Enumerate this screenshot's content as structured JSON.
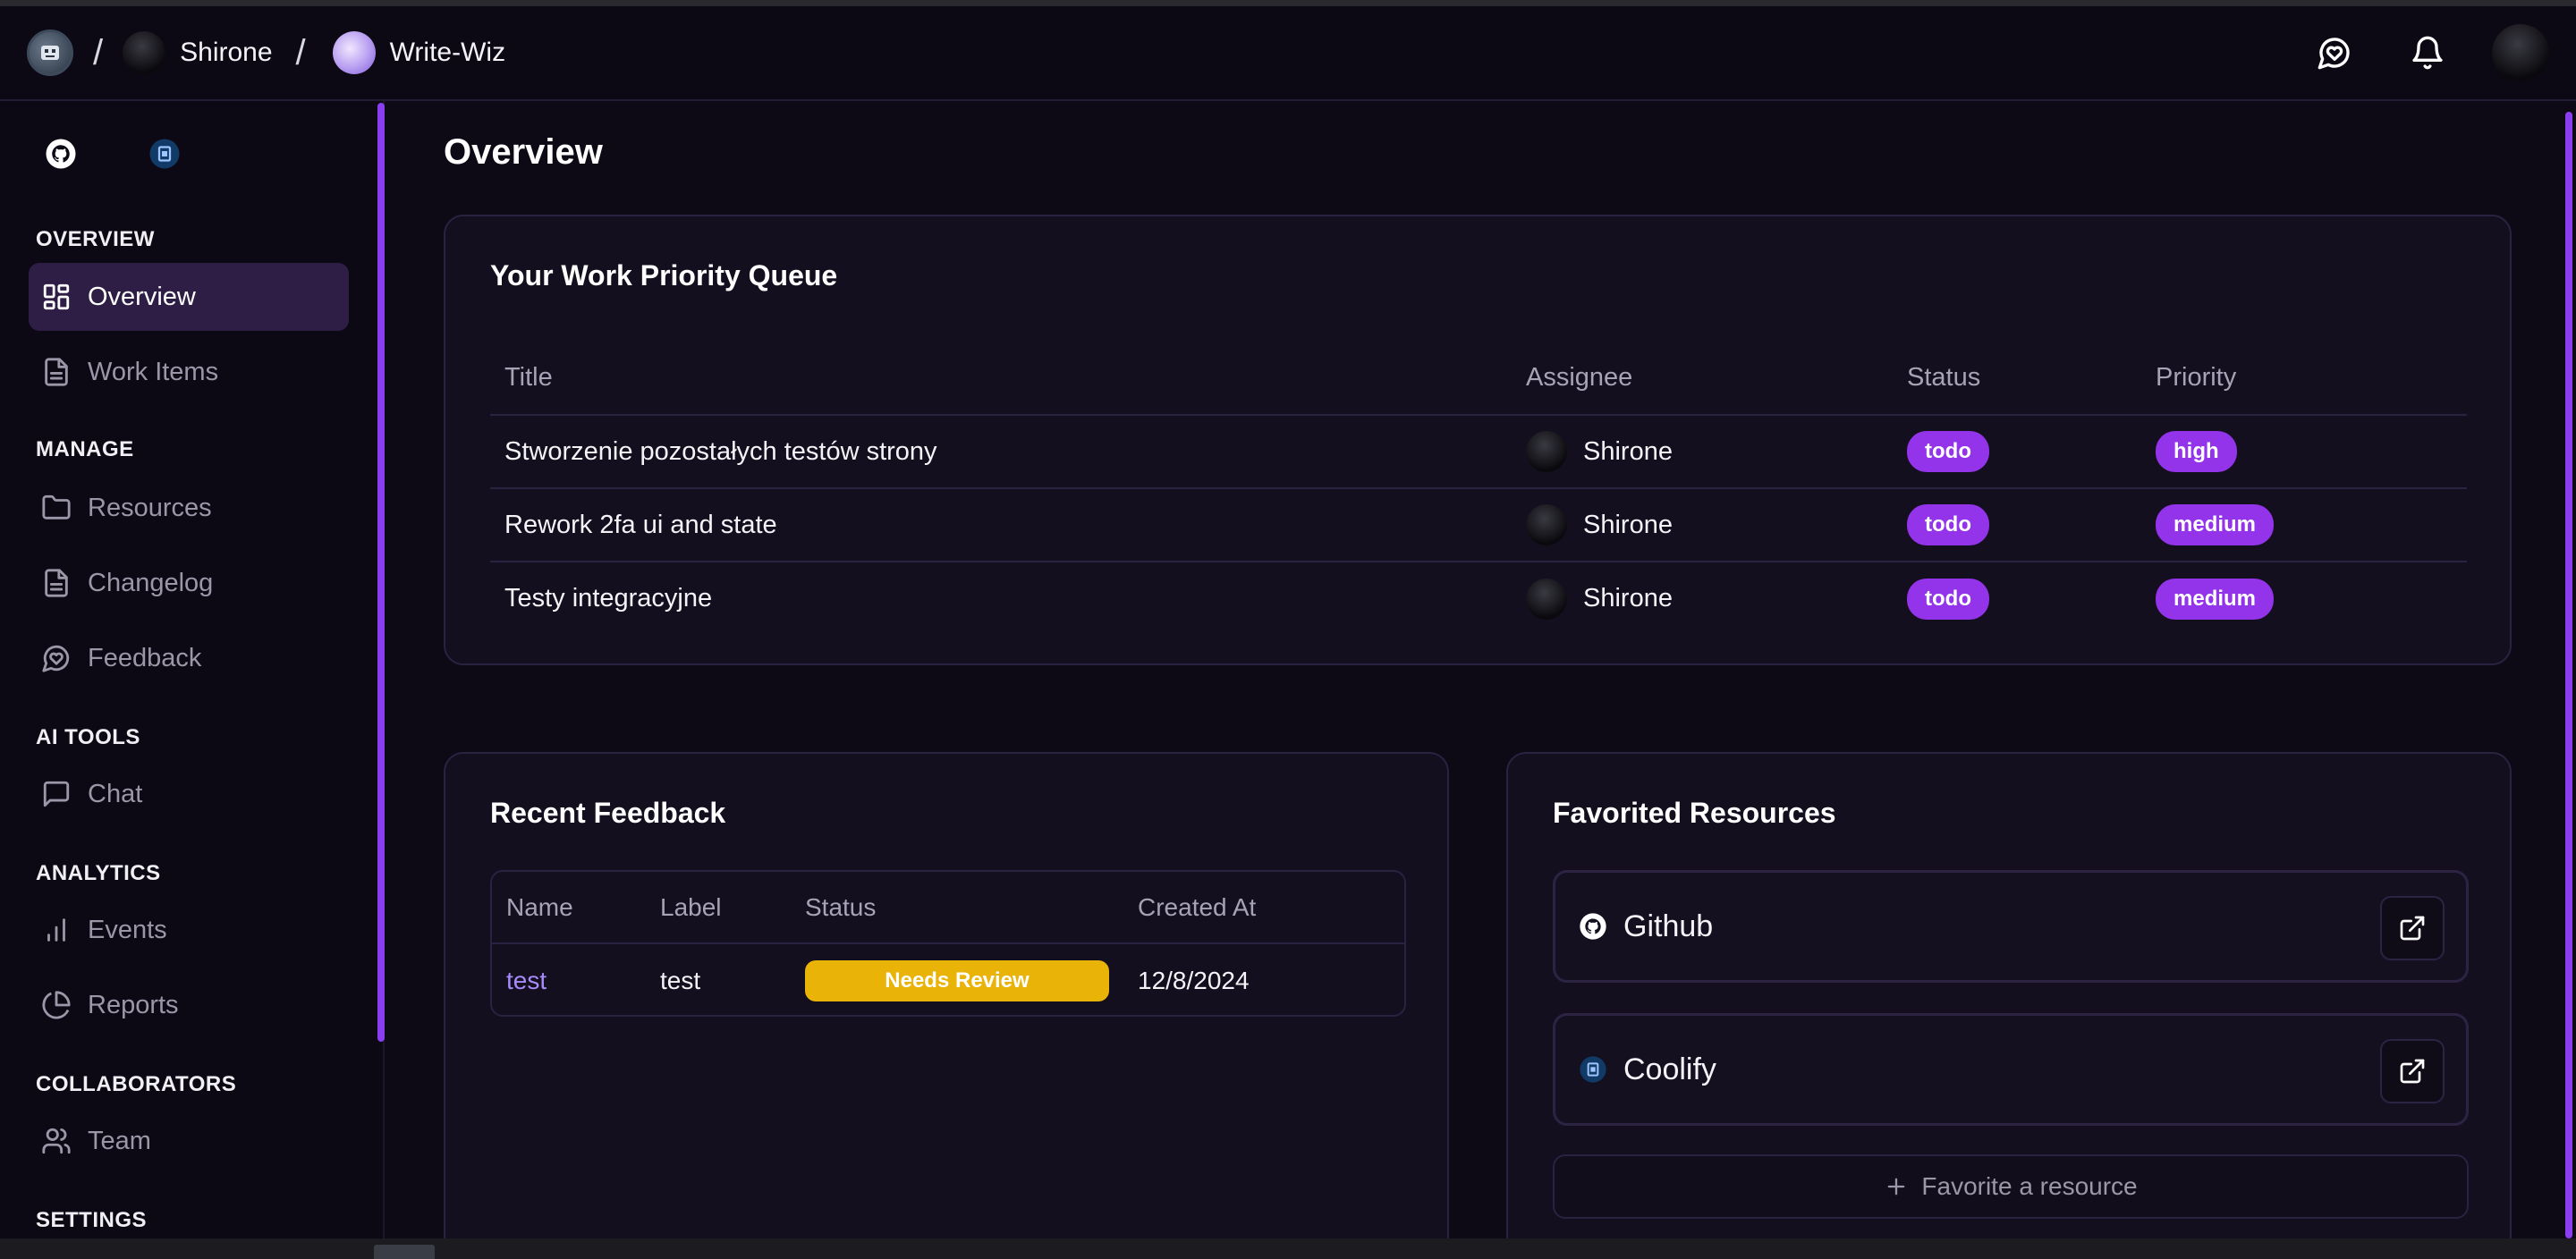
{
  "breadcrumb": {
    "user": "Shirone",
    "project": "Write-Wiz"
  },
  "icons": {
    "logo": "app-logo-icon",
    "feedback": "message-heart-icon",
    "notifications": "bell-icon",
    "github": "github-icon",
    "coolify": "coolify-icon",
    "external": "external-link-icon"
  },
  "sidebar": {
    "sections": {
      "overview": "OVERVIEW",
      "manage": "MANAGE",
      "ai_tools": "AI TOOLS",
      "analytics": "ANALYTICS",
      "collaborators": "COLLABORATORS",
      "settings": "SETTINGS"
    },
    "items": {
      "overview": "Overview",
      "work_items": "Work Items",
      "resources": "Resources",
      "changelog": "Changelog",
      "feedback": "Feedback",
      "chat": "Chat",
      "events": "Events",
      "reports": "Reports",
      "team": "Team"
    },
    "active": "Overview"
  },
  "main": {
    "title": "Overview",
    "priority_queue": {
      "title": "Your Work Priority Queue",
      "columns": [
        "Title",
        "Assignee",
        "Status",
        "Priority"
      ],
      "rows": [
        {
          "title": "Stworzenie pozostałych testów strony",
          "assignee": "Shirone",
          "status": "todo",
          "priority": "high"
        },
        {
          "title": "Rework 2fa ui and state",
          "assignee": "Shirone",
          "status": "todo",
          "priority": "medium"
        },
        {
          "title": "Testy integracyjne",
          "assignee": "Shirone",
          "status": "todo",
          "priority": "medium"
        }
      ]
    },
    "recent_feedback": {
      "title": "Recent Feedback",
      "columns": [
        "Name",
        "Label",
        "Status",
        "Created At"
      ],
      "rows": [
        {
          "name": "test",
          "label": "test",
          "status": "Needs Review",
          "created_at": "12/8/2024"
        }
      ]
    },
    "favorited_resources": {
      "title": "Favorited Resources",
      "items": [
        {
          "name": "Github"
        },
        {
          "name": "Coolify"
        }
      ],
      "add_label": "Favorite a resource"
    }
  },
  "colors": {
    "accent": "#9333ea",
    "warning": "#eab308",
    "background": "#0d0a16",
    "link": "#a78bfa"
  }
}
